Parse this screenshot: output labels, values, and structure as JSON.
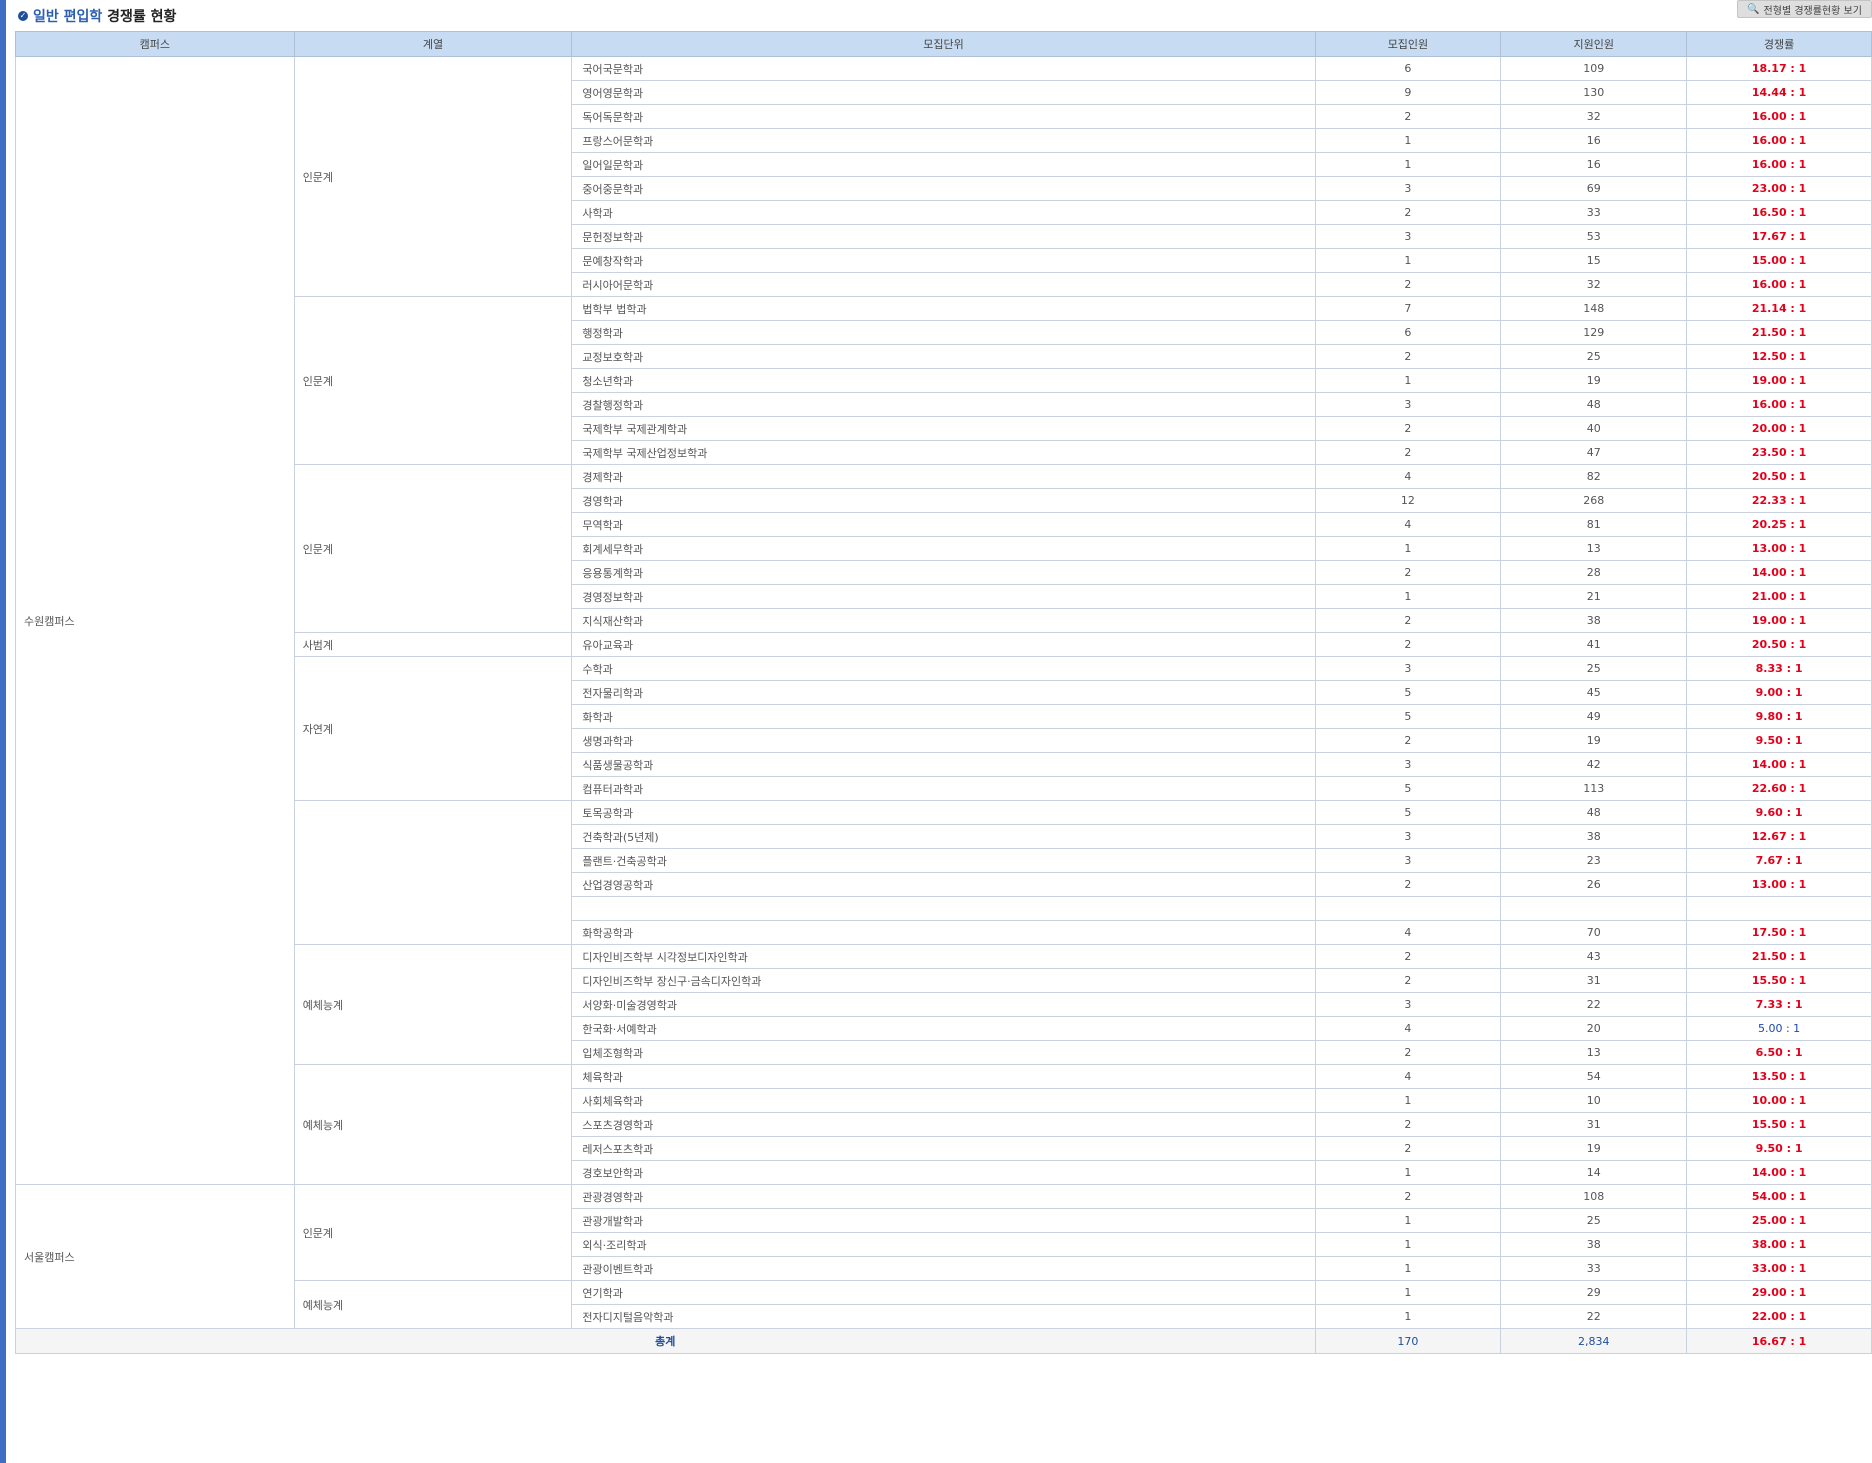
{
  "header": {
    "title_highlight": "일반 편입학",
    "title_rest": " 경쟁률 현황",
    "view_button_label": "전형별 경쟁률현황 보기"
  },
  "table": {
    "headers": [
      "캠퍼스",
      "계열",
      "모집단위",
      "모집인원",
      "지원인원",
      "경쟁률"
    ],
    "campuses": [
      {
        "name": "수원캠퍼스",
        "groups": [
          {
            "field": "인문계",
            "rows": [
              [
                "국어국문학과",
                "6",
                "109",
                "18.17 : 1"
              ],
              [
                "영어영문학과",
                "9",
                "130",
                "14.44 : 1"
              ],
              [
                "독어독문학과",
                "2",
                "32",
                "16.00 : 1"
              ],
              [
                "프랑스어문학과",
                "1",
                "16",
                "16.00 : 1"
              ],
              [
                "일어일문학과",
                "1",
                "16",
                "16.00 : 1"
              ],
              [
                "중어중문학과",
                "3",
                "69",
                "23.00 : 1"
              ],
              [
                "사학과",
                "2",
                "33",
                "16.50 : 1"
              ],
              [
                "문헌정보학과",
                "3",
                "53",
                "17.67 : 1"
              ],
              [
                "문예창작학과",
                "1",
                "15",
                "15.00 : 1"
              ],
              [
                "러시아어문학과",
                "2",
                "32",
                "16.00 : 1"
              ]
            ]
          },
          {
            "field": "인문계",
            "rows": [
              [
                "법학부 법학과",
                "7",
                "148",
                "21.14 : 1"
              ],
              [
                "행정학과",
                "6",
                "129",
                "21.50 : 1"
              ],
              [
                "교정보호학과",
                "2",
                "25",
                "12.50 : 1"
              ],
              [
                "청소년학과",
                "1",
                "19",
                "19.00 : 1"
              ],
              [
                "경찰행정학과",
                "3",
                "48",
                "16.00 : 1"
              ],
              [
                "국제학부 국제관계학과",
                "2",
                "40",
                "20.00 : 1"
              ],
              [
                "국제학부 국제산업정보학과",
                "2",
                "47",
                "23.50 : 1"
              ]
            ]
          },
          {
            "field": "인문계",
            "rows": [
              [
                "경제학과",
                "4",
                "82",
                "20.50 : 1"
              ],
              [
                "경영학과",
                "12",
                "268",
                "22.33 : 1"
              ],
              [
                "무역학과",
                "4",
                "81",
                "20.25 : 1"
              ],
              [
                "회계세무학과",
                "1",
                "13",
                "13.00 : 1"
              ],
              [
                "응용통계학과",
                "2",
                "28",
                "14.00 : 1"
              ],
              [
                "경영정보학과",
                "1",
                "21",
                "21.00 : 1"
              ],
              [
                "지식재산학과",
                "2",
                "38",
                "19.00 : 1"
              ]
            ]
          },
          {
            "field": "사범계",
            "rows": [
              [
                "유아교육과",
                "2",
                "41",
                "20.50 : 1"
              ]
            ]
          },
          {
            "field": "자연계",
            "rows": [
              [
                "수학과",
                "3",
                "25",
                "8.33 : 1"
              ],
              [
                "전자물리학과",
                "5",
                "45",
                "9.00 : 1"
              ],
              [
                "화학과",
                "5",
                "49",
                "9.80 : 1"
              ],
              [
                "생명과학과",
                "2",
                "19",
                "9.50 : 1"
              ],
              [
                "식품생물공학과",
                "3",
                "42",
                "14.00 : 1"
              ],
              [
                "컴퓨터과학과",
                "5",
                "113",
                "22.60 : 1"
              ]
            ]
          },
          {
            "field": "",
            "rows": [
              [
                "토목공학과",
                "5",
                "48",
                "9.60 : 1"
              ],
              [
                "건축학과(5년제)",
                "3",
                "38",
                "12.67 : 1"
              ],
              [
                "플랜트·건축공학과",
                "3",
                "23",
                "7.67 : 1"
              ],
              [
                "산업경영공학과",
                "2",
                "26",
                "13.00 : 1"
              ],
              [
                "",
                "",
                "",
                ""
              ],
              [
                "화학공학과",
                "4",
                "70",
                "17.50 : 1"
              ]
            ]
          },
          {
            "field": "예체능계",
            "rows": [
              [
                "디자인비즈학부 시각정보디자인학과",
                "2",
                "43",
                "21.50 : 1"
              ],
              [
                "디자인비즈학부 장신구·금속디자인학과",
                "2",
                "31",
                "15.50 : 1"
              ],
              [
                "서양화·미술경영학과",
                "3",
                "22",
                "7.33 : 1"
              ],
              [
                "한국화·서예학과",
                "4",
                "20",
                "5.00 : 1"
              ],
              [
                "입체조형학과",
                "2",
                "13",
                "6.50 : 1"
              ]
            ]
          },
          {
            "field": "예체능계",
            "rows": [
              [
                "체육학과",
                "4",
                "54",
                "13.50 : 1"
              ],
              [
                "사회체육학과",
                "1",
                "10",
                "10.00 : 1"
              ],
              [
                "스포츠경영학과",
                "2",
                "31",
                "15.50 : 1"
              ],
              [
                "레저스포츠학과",
                "2",
                "19",
                "9.50 : 1"
              ],
              [
                "경호보안학과",
                "1",
                "14",
                "14.00 : 1"
              ]
            ]
          }
        ]
      },
      {
        "name": "서울캠퍼스",
        "groups": [
          {
            "field": "인문계",
            "rows": [
              [
                "관광경영학과",
                "2",
                "108",
                "54.00 : 1"
              ],
              [
                "관광개발학과",
                "1",
                "25",
                "25.00 : 1"
              ],
              [
                "외식·조리학과",
                "1",
                "38",
                "38.00 : 1"
              ],
              [
                "관광이벤트학과",
                "1",
                "33",
                "33.00 : 1"
              ]
            ]
          },
          {
            "field": "예체능계",
            "rows": [
              [
                "연기학과",
                "1",
                "29",
                "29.00 : 1"
              ],
              [
                "전자디지털음악학과",
                "1",
                "22",
                "22.00 : 1"
              ]
            ]
          }
        ]
      }
    ],
    "total": {
      "label": "총계",
      "quota": "170",
      "applicants": "2,834",
      "rate": "16.67 : 1"
    }
  },
  "colors": {
    "header_bg": "#c7dcf3",
    "rate_red": "#e3001b",
    "rate_blue": "#1a49b0",
    "accent": "#2d5fb1"
  }
}
